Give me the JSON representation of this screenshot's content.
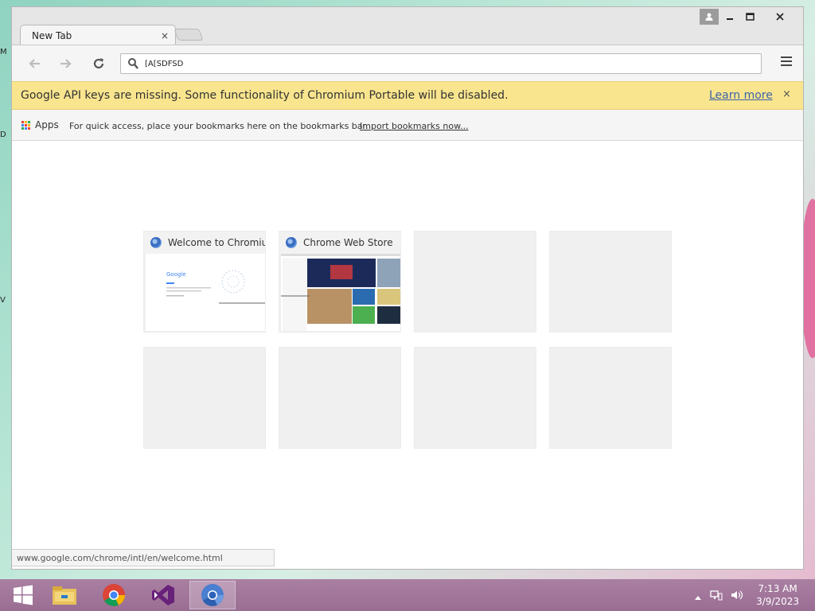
{
  "desktop": {
    "edge_letters": [
      "M",
      "D",
      "V"
    ]
  },
  "window": {
    "tab": {
      "title": "New Tab",
      "close_glyph": "×"
    },
    "controls": {
      "minimize": "—",
      "maximize": "□",
      "close": "✕"
    }
  },
  "toolbar": {
    "omnibox_value": "[A[SDFSD",
    "icons": [
      "back-arrow-icon",
      "forward-arrow-icon",
      "reload-icon",
      "search-icon",
      "hamburger-menu-icon"
    ]
  },
  "infobar": {
    "message": "Google API keys are missing. Some functionality of Chromium Portable will be disabled.",
    "link": "Learn more",
    "close_glyph": "×"
  },
  "bookmarks_bar": {
    "apps_label": "Apps",
    "hint": "For quick access, place your bookmarks here on the bookmarks bar.",
    "import_link": "Import bookmarks now..."
  },
  "most_visited": [
    {
      "title": "Welcome to Chromium"
    },
    {
      "title": "Chrome Web Store"
    }
  ],
  "status_url": "www.google.com/chrome/intl/en/welcome.html",
  "taskbar": {
    "apps": [
      "windows-start-icon",
      "file-explorer-icon",
      "chrome-icon",
      "visual-studio-icon",
      "chromium-icon"
    ],
    "clock_time": "7:13 AM",
    "clock_date": "3/9/2023"
  },
  "colors": {
    "infobar_bg": "#f9e58e",
    "link": "#3d63a8",
    "taskbar": "#9a6e93"
  }
}
